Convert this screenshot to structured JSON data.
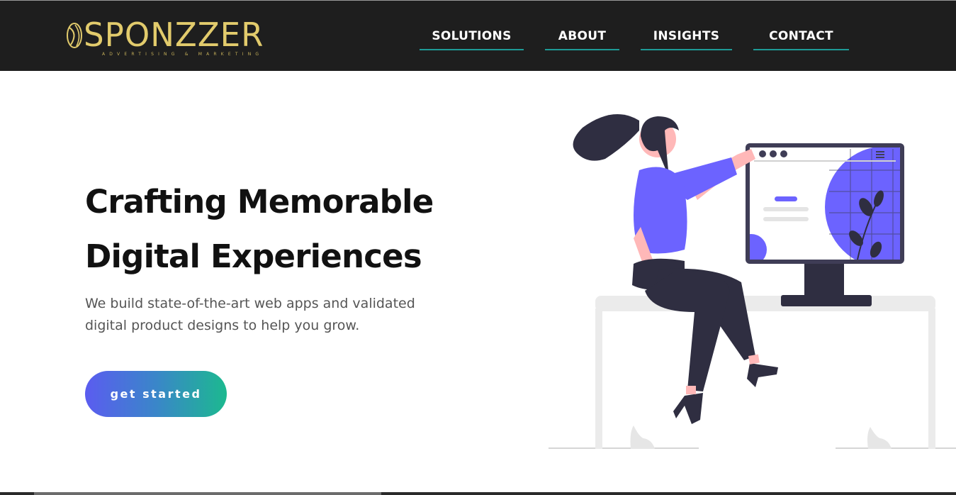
{
  "brand": {
    "name": "SPONZZER",
    "tagline": "ADVERTISING & MARKETING",
    "color": "#e2cb6c"
  },
  "nav": {
    "items": [
      {
        "label": "SOLUTIONS"
      },
      {
        "label": "ABOUT"
      },
      {
        "label": "INSIGHTS"
      },
      {
        "label": "CONTACT"
      }
    ],
    "underline_color": "#1e9b97",
    "background": "#1e1e1e"
  },
  "hero": {
    "title_line1": "Crafting Memorable",
    "title_line2": "Digital Experiences",
    "subtitle_line1": "We build state-of-the-art web apps and validated",
    "subtitle_line2": "digital product designs to help you grow.",
    "cta_label": "get started",
    "cta_gradient": [
      "#5b5cf0",
      "#1cb98f"
    ]
  },
  "illustration": {
    "accent_color": "#6c63ff",
    "dark_color": "#2f2e41",
    "skin_color": "#ffb8b8"
  }
}
